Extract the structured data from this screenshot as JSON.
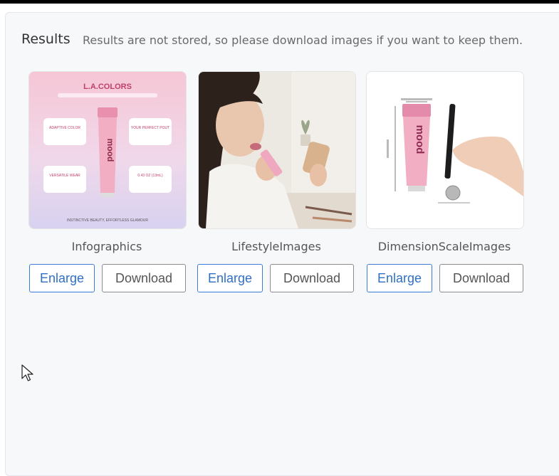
{
  "panel": {
    "title": "Results",
    "note": "Results are not stored, so please download images if you want to keep them."
  },
  "results": [
    {
      "caption": "Infographics",
      "enlarge_label": "Enlarge",
      "download_label": "Download",
      "image": {
        "brand": "L.A.COLORS",
        "product": "mood",
        "features": [
          "ADAPTIVE COLOR",
          "YOUR PERFECT POUT",
          "VERSATILE WEAR",
          "0.43 OZ (13mL)"
        ],
        "tagline": "INSTINCTIVE BEAUTY, EFFORTLESS GLAMOUR"
      }
    },
    {
      "caption": "LifestyleImages",
      "enlarge_label": "Enlarge",
      "download_label": "Download"
    },
    {
      "caption": "DimensionScaleImages",
      "enlarge_label": "Enlarge",
      "download_label": "Download",
      "image": {
        "product": "mood"
      }
    }
  ],
  "colors": {
    "accent": "#2f6fc7",
    "panel_bg": "#f7f8fa",
    "pink": "#f2aec3"
  },
  "icons": [
    "mouse-pointer-icon"
  ]
}
